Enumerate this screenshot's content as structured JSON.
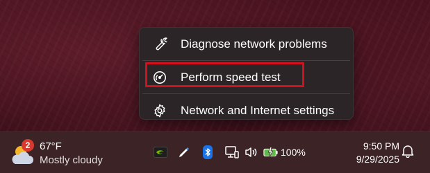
{
  "context_menu": {
    "items": [
      {
        "label": "Diagnose network problems",
        "icon": "wrench-icon"
      },
      {
        "label": "Perform speed test",
        "icon": "speedometer-icon"
      },
      {
        "label": "Network and Internet settings",
        "icon": "gear-icon"
      }
    ],
    "highlight_color": "#d4101c"
  },
  "taskbar": {
    "weather": {
      "temperature": "67°F",
      "condition": "Mostly cloudy",
      "badge_count": "2",
      "icon": "partly-cloudy-icon"
    },
    "tray": {
      "icons": [
        "nvidia-icon",
        "pen-icon",
        "bluetooth-icon",
        "network-icon",
        "volume-icon",
        "battery-icon"
      ],
      "battery_percent": "100%"
    },
    "clock": {
      "time": "9:50 PM",
      "date": "9/29/2025"
    },
    "notifications_icon": "bell-icon"
  }
}
